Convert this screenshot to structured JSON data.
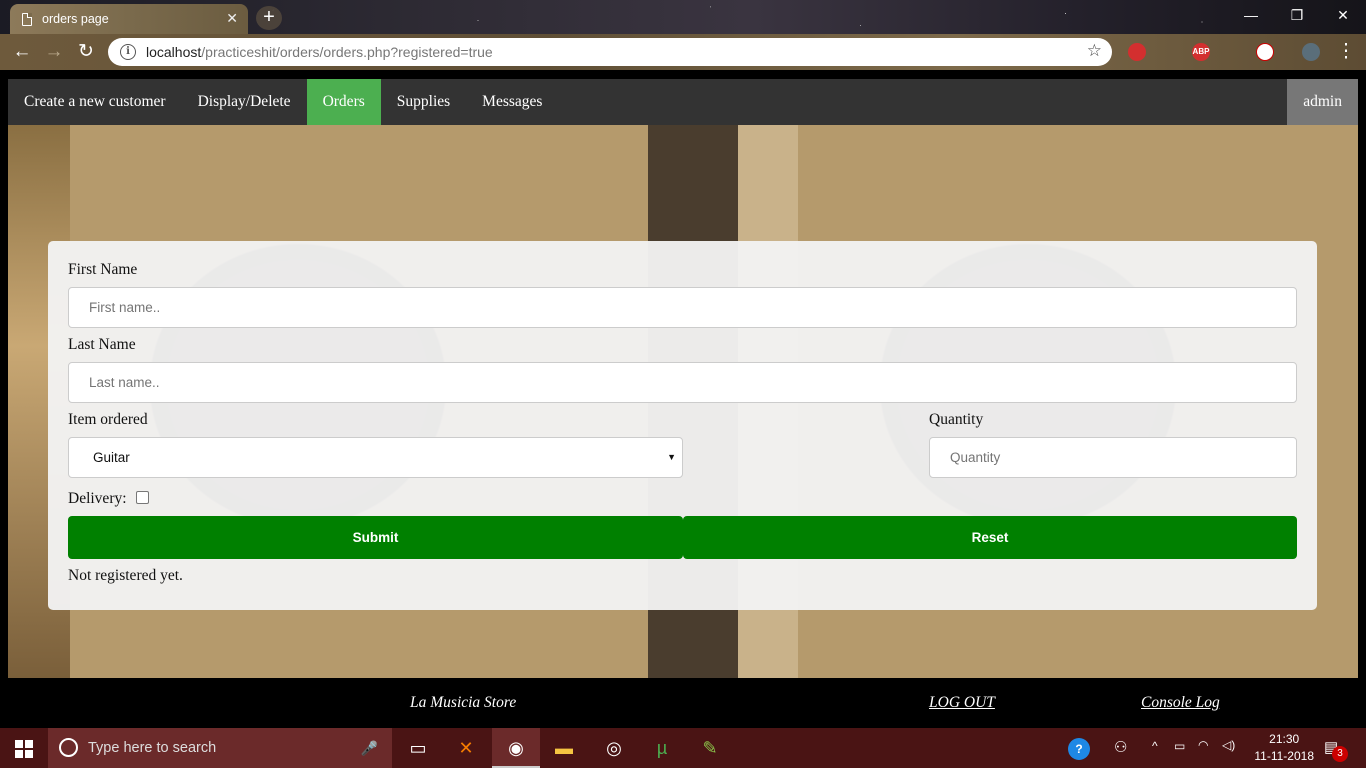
{
  "browser": {
    "tab_title": "orders page",
    "tab_close": "✕",
    "new_tab": "+",
    "url_host": "localhost",
    "url_path": "/practiceshit/orders/orders.php?registered=true"
  },
  "navbar": {
    "items": [
      "Create a new customer",
      "Display/Delete",
      "Orders",
      "Supplies",
      "Messages"
    ],
    "active": "Orders",
    "user": "admin"
  },
  "form": {
    "first_name_label": "First Name",
    "first_name_placeholder": "First name..",
    "last_name_label": "Last Name",
    "last_name_placeholder": "Last name..",
    "item_label": "Item ordered",
    "item_selected": "Guitar",
    "quantity_label": "Quantity",
    "quantity_placeholder": "Quantity",
    "delivery_label": "Delivery:",
    "submit_label": "Submit",
    "reset_label": "Reset",
    "status_text": "Not registered yet."
  },
  "footer": {
    "store_name": "La Musicia Store",
    "logout_label": "LOG OUT",
    "console_label": "Console Log"
  },
  "taskbar": {
    "search_placeholder": "Type here to search",
    "time": "21:30",
    "date": "11-11-2018",
    "notification_count": "3"
  },
  "colors": {
    "accent_green": "#4caf50",
    "button_green": "#008000",
    "nav_bg": "#333333",
    "admin_bg": "#777777"
  }
}
